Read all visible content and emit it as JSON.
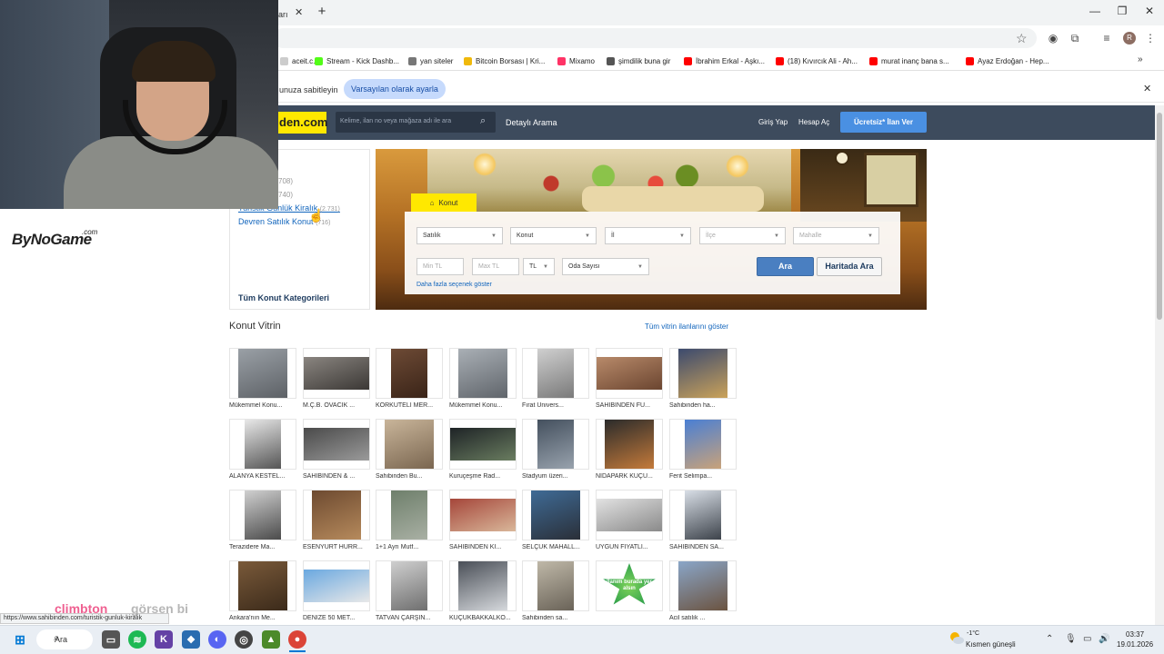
{
  "browser": {
    "tab_title": "ları",
    "bookmarks": [
      {
        "label": "aceit.c...",
        "color": "#cccccc"
      },
      {
        "label": "Stream - Kick Dashb...",
        "color": "#53fc18"
      },
      {
        "label": "yan siteler",
        "color": "#777777"
      },
      {
        "label": "Bitcoin Borsası | Kri...",
        "color": "#f0b90b"
      },
      {
        "label": "Mixamo",
        "color": "#ff3366"
      },
      {
        "label": "şimdilik buna gir",
        "color": "#555555"
      },
      {
        "label": "İbrahim Erkal - Aşkı...",
        "color": "#ff0000"
      },
      {
        "label": "(18) Kıvırcık Ali - Ah...",
        "color": "#ff0000"
      },
      {
        "label": "murat inanç bana s...",
        "color": "#ff0000"
      },
      {
        "label": "Ayaz Erdoğan - Hep...",
        "color": "#ff0000"
      }
    ],
    "infobar_text": "unuza sabitleyin",
    "infobar_button": "Varsayılan olarak ayarla",
    "status_url": "https://www.sahibinden.com/turistik-gunluk-kiralik"
  },
  "site": {
    "logo": "den.com",
    "search_placeholder": "Kelime, ilan no veya mağaza adı ile ara",
    "detailed_search": "Detaylı Arama",
    "login": "Giriş Yap",
    "register": "Hesap Aç",
    "post_ad": "Ücretsiz* İlan Ver"
  },
  "sidebar": {
    "count1": "708)",
    "count2": "740)",
    "items": [
      {
        "label": "Turistik Günlük Kiralık",
        "count": "(2.731)"
      },
      {
        "label": "Devren Satılık Konut",
        "count": "(716)"
      }
    ],
    "all_categories": "Tüm Konut Kategorileri"
  },
  "search_form": {
    "tab_label": "Konut",
    "type": "Satılık",
    "category": "Konut",
    "province": "İl",
    "district": "İlçe",
    "neighborhood": "Mahalle",
    "min_price": "Min TL",
    "max_price": "Max TL",
    "currency": "TL",
    "rooms": "Oda Sayısı",
    "search_button": "Ara",
    "map_button": "Haritada Ara",
    "more_options": "Daha fazla seçenek göster"
  },
  "showcase": {
    "title": "Konut Vitrin",
    "all_link": "Tüm vitrin ilanlarını göster",
    "rows": [
      [
        {
          "caption": "Mükemmel Konu...",
          "c1": "#9aa0a6",
          "c2": "#5d6166"
        },
        {
          "caption": "M.Ç.B. OVACIK ...",
          "c1": "#8a8580",
          "c2": "#3b3835"
        },
        {
          "caption": "KORKUTELİ MER...",
          "c1": "#6d4a35",
          "c2": "#3a2418"
        },
        {
          "caption": "Mükemmel Konu...",
          "c1": "#a9afb5",
          "c2": "#60656b"
        },
        {
          "caption": "Fırat Ünivers...",
          "c1": "#cfcfcf",
          "c2": "#7a7a7a"
        },
        {
          "caption": "SAHİBİNDEN FU...",
          "c1": "#b88a6a",
          "c2": "#6b4530"
        },
        {
          "caption": "Sahibinden ha...",
          "c1": "#3c4a6e",
          "c2": "#caa25a"
        }
      ],
      [
        {
          "caption": "ALANYA KESTEL...",
          "c1": "#e8e8e8",
          "c2": "#555555"
        },
        {
          "caption": "SAHİBİNDEN & ...",
          "c1": "#4a4a4a",
          "c2": "#9a9a9a"
        },
        {
          "caption": "Sahibinden Bu...",
          "c1": "#c9b59a",
          "c2": "#7a6650"
        },
        {
          "caption": "Kuruçeşme Rad...",
          "c1": "#1e2326",
          "c2": "#6a7d60"
        },
        {
          "caption": "Stadyum üzeri...",
          "c1": "#44505e",
          "c2": "#98a2ad"
        },
        {
          "caption": "NİDAPARK KÜÇÜ...",
          "c1": "#2b2b2b",
          "c2": "#c47a3a"
        },
        {
          "caption": "Ferit Selimpa...",
          "c1": "#4a7fd4",
          "c2": "#c8a27a"
        }
      ],
      [
        {
          "caption": "Terazidere Ma...",
          "c1": "#d0d0d0",
          "c2": "#4b4b4b"
        },
        {
          "caption": "ESENYURT HÜRR...",
          "c1": "#6d4a30",
          "c2": "#b68a5c"
        },
        {
          "caption": "1+1 Ayrı Mutf...",
          "c1": "#6e7f6b",
          "c2": "#a9b0a4"
        },
        {
          "caption": "SAHİBİNDEN Kİ...",
          "c1": "#a5463a",
          "c2": "#d9b79a"
        },
        {
          "caption": "SELÇUK MAHALL...",
          "c1": "#3f6b96",
          "c2": "#2a2f38"
        },
        {
          "caption": "UYGUN FİYATLI...",
          "c1": "#e2e2e2",
          "c2": "#8a8a8a"
        },
        {
          "caption": "SAHİBİNDEN SA...",
          "c1": "#d8dee6",
          "c2": "#3d434b"
        }
      ],
      [
        {
          "caption": "Ankara'nın Me...",
          "c1": "#7a5a3a",
          "c2": "#3b2a1a"
        },
        {
          "caption": "DENİZE 50 MET...",
          "c1": "#6aa8e0",
          "c2": "#e8e8e8"
        },
        {
          "caption": "TATVAN ÇARŞIN...",
          "c1": "#cfcfcf",
          "c2": "#6f6f6f"
        },
        {
          "caption": "KÜÇÜKBAKKALKÖ...",
          "c1": "#4a4f57",
          "c2": "#d5d8dc"
        },
        {
          "caption": "Sahibinden sa...",
          "c1": "#bfb8a8",
          "c2": "#6a6358"
        },
        {
          "caption": "",
          "c1": "#2a9d4b",
          "c2": "#7fd35a",
          "badge": "İlanım burada yer alsın"
        },
        {
          "caption": "Acil satılık ...",
          "c1": "#8aa6c8",
          "c2": "#6b5340"
        }
      ]
    ]
  },
  "overlay": {
    "brand": "ByNoGame",
    "brand_suffix": ".com",
    "chat_user": "climbton",
    "chat_text": "görsen bi"
  },
  "taskbar": {
    "search": "Ara",
    "temp": "-1°C",
    "weather": "Kısmen güneşli",
    "time": "03:37",
    "date": "19.01.2026"
  }
}
